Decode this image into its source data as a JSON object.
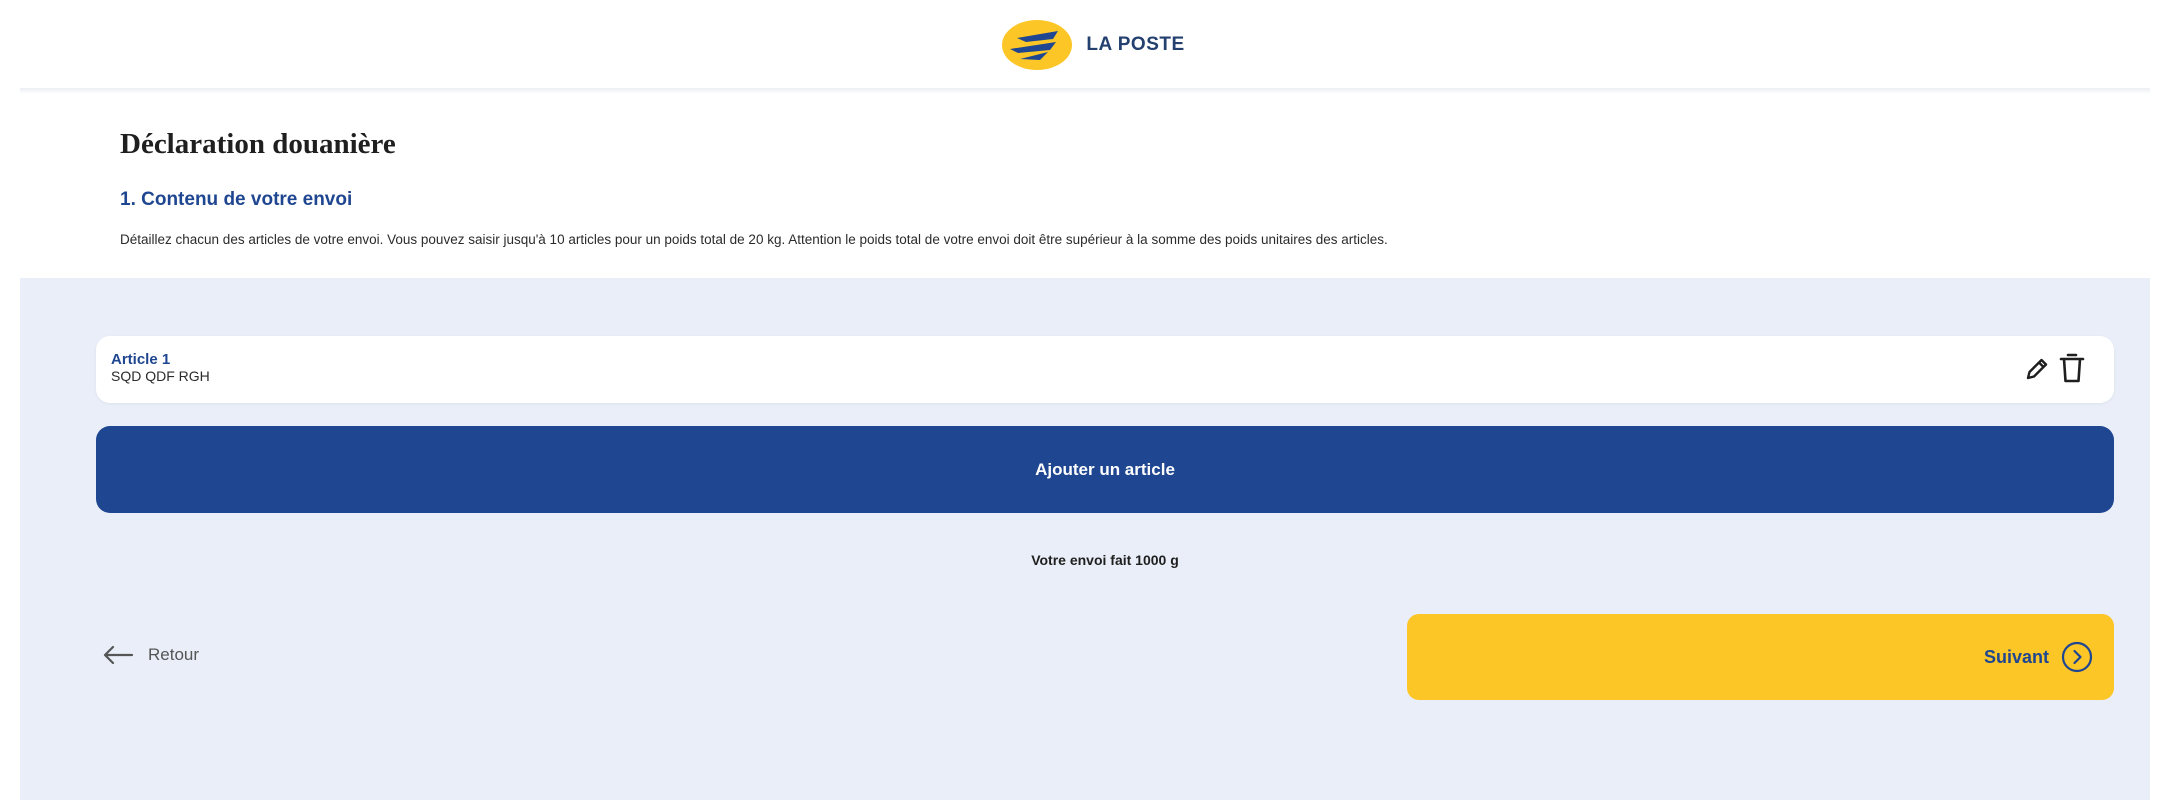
{
  "header": {
    "brand_name": "LA POSTE"
  },
  "intro": {
    "title": "Déclaration douanière",
    "section_title": "1. Contenu de votre envoi",
    "description": "Détaillez chacun des articles de votre envoi. Vous pouvez saisir jusqu'à 10 articles pour un poids total de 20 kg. Attention le poids total de votre envoi doit être supérieur à la somme des poids unitaires des articles."
  },
  "articles": [
    {
      "name": "Article 1",
      "description": "SQD QDF RGH"
    }
  ],
  "actions": {
    "add_label": "Ajouter un article",
    "weight_summary": "Votre envoi fait 1000 g",
    "back_label": "Retour",
    "next_label": "Suivant"
  },
  "icons": {
    "logo": "la-poste-logo",
    "edit": "pencil-icon",
    "delete": "trash-icon",
    "back": "arrow-left-icon",
    "next": "chevron-right-circle-icon"
  },
  "colors": {
    "brand_blue": "#1f4690",
    "brand_yellow": "#fdc627",
    "panel_background": "#e9eef8",
    "card_background": "#ffffff"
  }
}
